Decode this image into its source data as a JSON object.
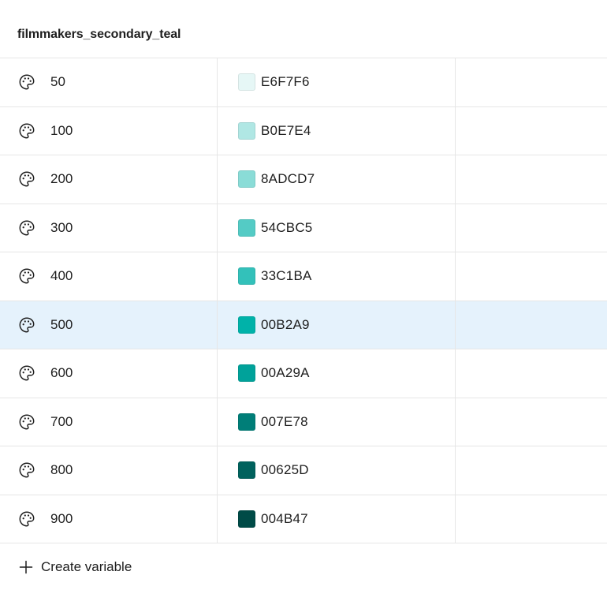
{
  "group": {
    "title": "filmmakers_secondary_teal"
  },
  "variables": [
    {
      "name": "50",
      "hex": "E6F7F6",
      "color": "#E6F7F6",
      "selected": false
    },
    {
      "name": "100",
      "hex": "B0E7E4",
      "color": "#B0E7E4",
      "selected": false
    },
    {
      "name": "200",
      "hex": "8ADCD7",
      "color": "#8ADCD7",
      "selected": false
    },
    {
      "name": "300",
      "hex": "54CBC5",
      "color": "#54CBC5",
      "selected": false
    },
    {
      "name": "400",
      "hex": "33C1BA",
      "color": "#33C1BA",
      "selected": false
    },
    {
      "name": "500",
      "hex": "00B2A9",
      "color": "#00B2A9",
      "selected": true
    },
    {
      "name": "600",
      "hex": "00A29A",
      "color": "#00A29A",
      "selected": false
    },
    {
      "name": "700",
      "hex": "007E78",
      "color": "#007E78",
      "selected": false
    },
    {
      "name": "800",
      "hex": "00625D",
      "color": "#00625D",
      "selected": false
    },
    {
      "name": "900",
      "hex": "004B47",
      "color": "#004B47",
      "selected": false
    }
  ],
  "icons": {
    "variable": "palette-icon",
    "create": "plus-icon"
  },
  "create": {
    "label": "Create variable"
  }
}
